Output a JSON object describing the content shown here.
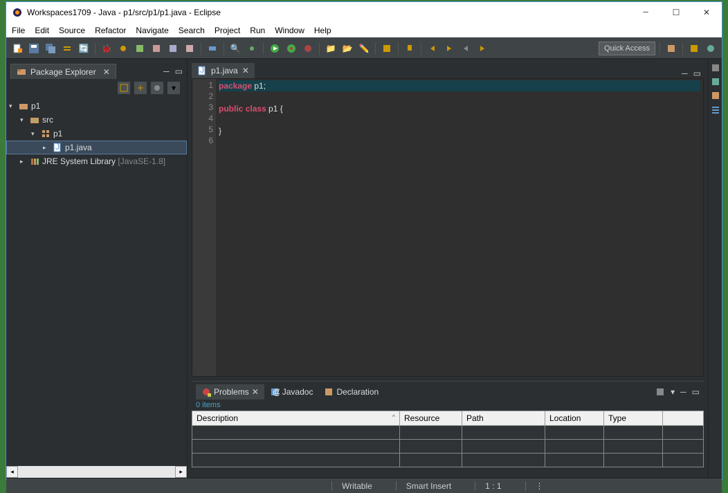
{
  "window": {
    "title": "Workspaces1709 - Java - p1/src/p1/p1.java - Eclipse"
  },
  "menu": [
    "File",
    "Edit",
    "Source",
    "Refactor",
    "Navigate",
    "Search",
    "Project",
    "Run",
    "Window",
    "Help"
  ],
  "toolbar": {
    "quick_access": "Quick Access"
  },
  "package_explorer": {
    "title": "Package Explorer",
    "tree": {
      "project": "p1",
      "src": "src",
      "pkg": "p1",
      "file": "p1.java",
      "jre": "JRE System Library",
      "jre_suffix": "[JavaSE-1.8]"
    }
  },
  "editor": {
    "tab": "p1.java",
    "lines": [
      "1",
      "2",
      "3",
      "4",
      "5",
      "6"
    ],
    "code": {
      "l1_kw": "package",
      "l1_txt": " p1;",
      "l3_kw1": "public",
      "l3_kw2": "class",
      "l3_txt": " p1 {",
      "l5": "}"
    }
  },
  "bottom": {
    "tabs": {
      "problems": "Problems",
      "javadoc": "Javadoc",
      "declaration": "Declaration"
    },
    "count": "0 items",
    "cols": [
      "Description",
      "Resource",
      "Path",
      "Location",
      "Type"
    ]
  },
  "statusbar": {
    "writable": "Writable",
    "insert": "Smart Insert",
    "pos": "1 : 1"
  }
}
